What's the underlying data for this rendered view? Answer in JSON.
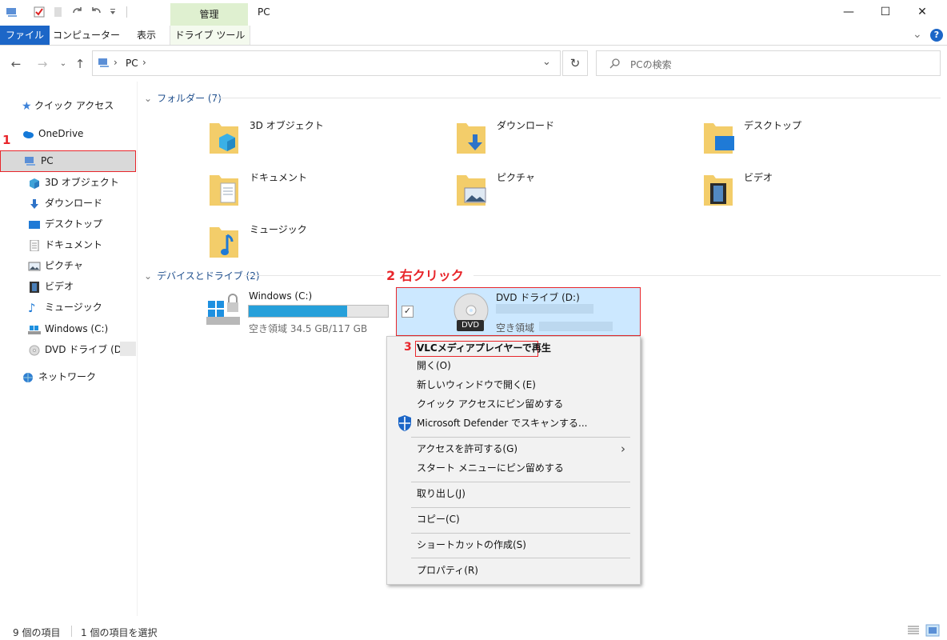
{
  "titlebar": {
    "manage_tab": "管理",
    "window_title": "PC",
    "minimize": "—",
    "maximize": "☐",
    "close": "✕"
  },
  "ribbon": {
    "tab_file": "ファイル",
    "tab_computer": "コンピューター",
    "tab_view": "表示",
    "tab_drive_tools": "ドライブ ツール",
    "expand": "⌄",
    "help": "?"
  },
  "address": {
    "crumb": "PC",
    "sep1": "›",
    "sep2": "›",
    "search_placeholder": "PCの検索"
  },
  "sidebar": {
    "quick_access": "クイック アクセス",
    "onedrive": "OneDrive",
    "pc": "PC",
    "objects3d": "3D オブジェクト",
    "downloads": "ダウンロード",
    "desktop": "デスクトップ",
    "documents": "ドキュメント",
    "pictures": "ピクチャ",
    "videos": "ビデオ",
    "music": "ミュージック",
    "drive_c": "Windows (C:)",
    "drive_d": "DVD ドライブ (D:)",
    "network": "ネットワーク"
  },
  "main": {
    "folders_header": "フォルダー (7)",
    "folders": {
      "objects3d": "3D オブジェクト",
      "downloads": "ダウンロード",
      "desktop": "デスクトップ",
      "documents": "ドキュメント",
      "pictures": "ピクチャ",
      "videos": "ビデオ",
      "music": "ミュージック"
    },
    "devices_header": "デバイスとドライブ (2)",
    "drive_c": {
      "name": "Windows (C:)",
      "free": "空き領域 34.5 GB/117 GB",
      "used_fraction": 0.705
    },
    "drive_d": {
      "name": "DVD ドライブ (D:)",
      "free_label": "空き領域",
      "badge": "DVD"
    }
  },
  "annotations": {
    "step1": "1",
    "step2": "2 右クリック",
    "step3": "3",
    "color": "#e8262b"
  },
  "context_menu": {
    "vlc": "VLCメディアプレイヤーで再生",
    "open": "開く(O)",
    "open_new_window": "新しいウィンドウで開く(E)",
    "pin_quick": "クイック アクセスにピン留めする",
    "defender": "Microsoft Defender でスキャンする...",
    "grant_access": "アクセスを許可する(G)",
    "pin_start": "スタート メニューにピン留めする",
    "eject": "取り出し(J)",
    "copy": "コピー(C)",
    "create_shortcut": "ショートカットの作成(S)",
    "properties": "プロパティ(R)"
  },
  "status": {
    "items": "9 個の項目",
    "selected": "1 個の項目を選択"
  }
}
